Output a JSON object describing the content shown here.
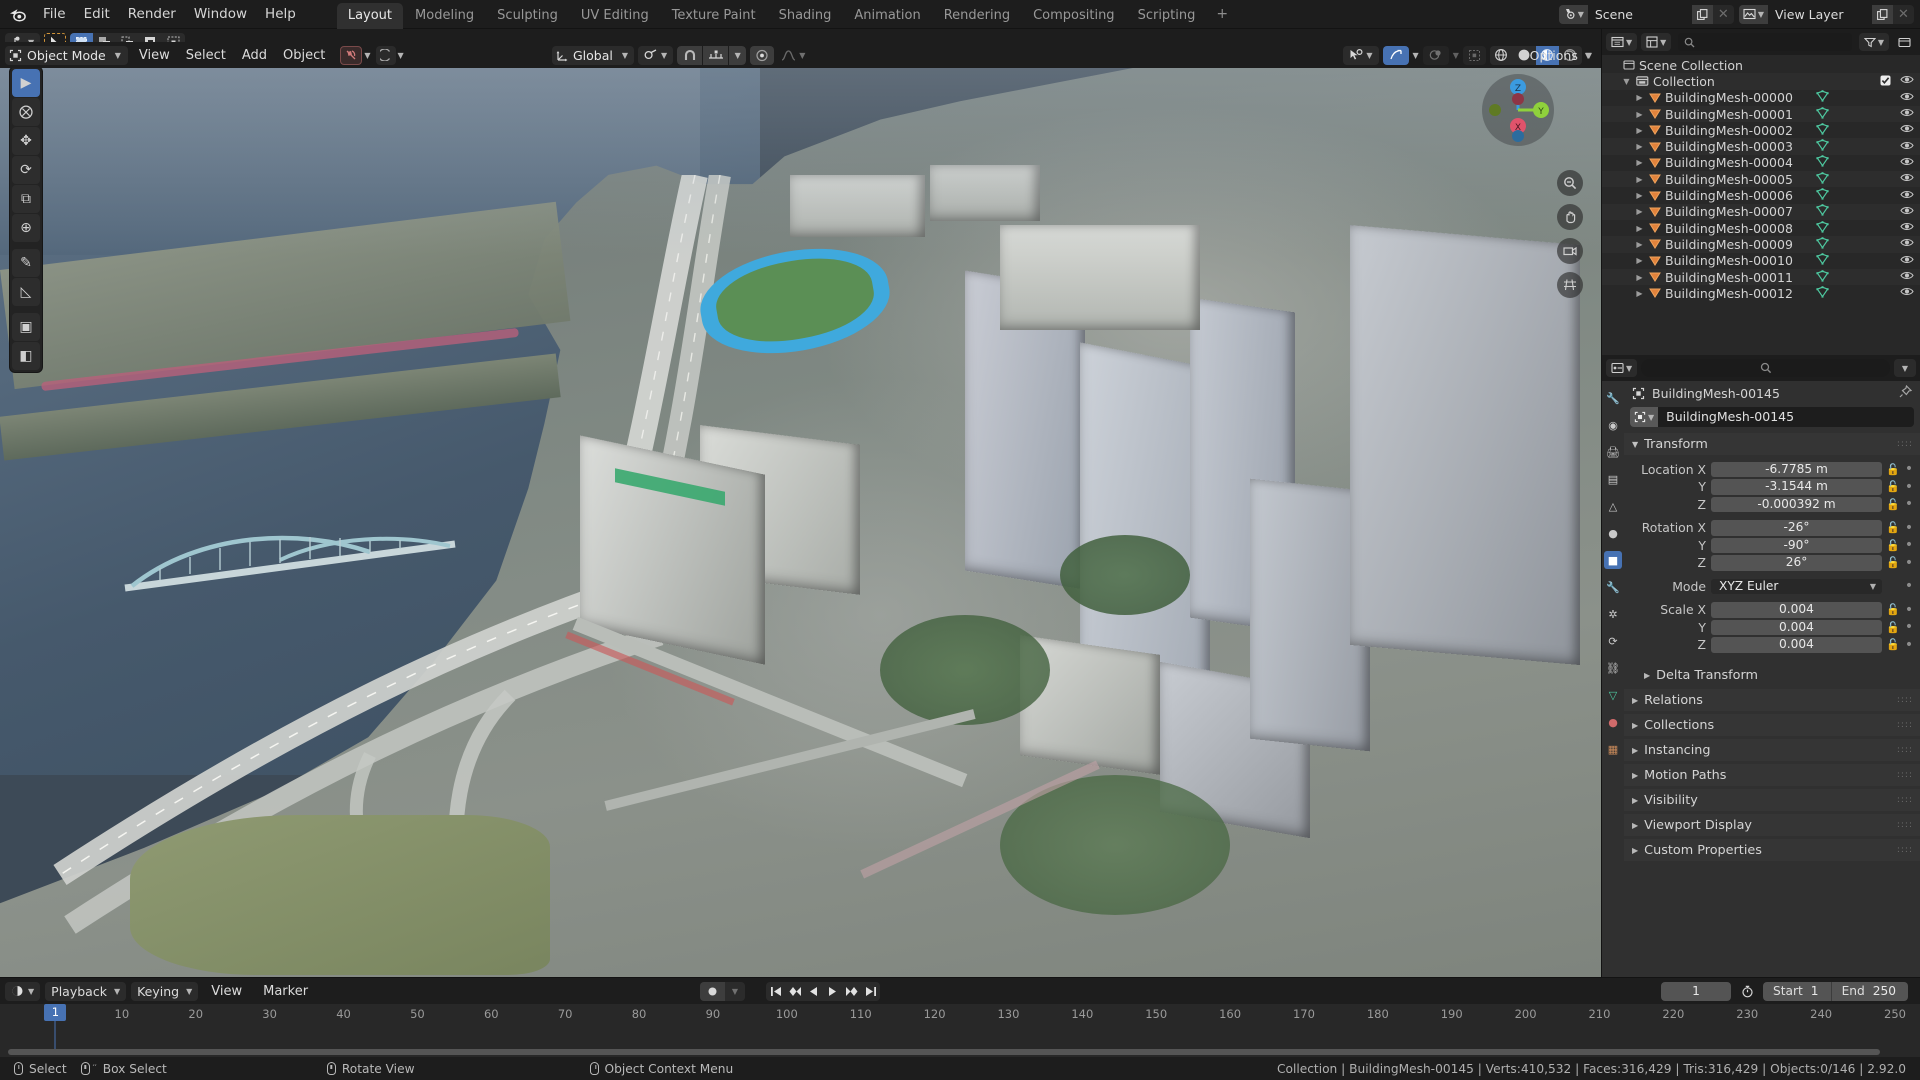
{
  "app": {
    "name": "Blender",
    "version": "2.92.0"
  },
  "topbar": {
    "menus": [
      "File",
      "Edit",
      "Render",
      "Window",
      "Help"
    ],
    "workspaces": [
      {
        "label": "Layout",
        "active": true
      },
      {
        "label": "Modeling",
        "active": false
      },
      {
        "label": "Sculpting",
        "active": false
      },
      {
        "label": "UV Editing",
        "active": false
      },
      {
        "label": "Texture Paint",
        "active": false
      },
      {
        "label": "Shading",
        "active": false
      },
      {
        "label": "Animation",
        "active": false
      },
      {
        "label": "Rendering",
        "active": false
      },
      {
        "label": "Compositing",
        "active": false
      },
      {
        "label": "Scripting",
        "active": false
      }
    ],
    "add_workspace": "+",
    "scene": {
      "icon": "scene-icon",
      "name": "Scene"
    },
    "view_layer": {
      "icon": "view-layer-icon",
      "name": "View Layer"
    }
  },
  "viewport_header": {
    "mode": "Object Mode",
    "menus": [
      "View",
      "Select",
      "Add",
      "Object"
    ],
    "transform_orientation": "Global",
    "snap_icon": "magnet-icon",
    "proportional_icon": "proportional-edit-icon",
    "options_label": "Options"
  },
  "viewport": {
    "gizmo_axes": [
      "X",
      "Y",
      "Z"
    ],
    "tools": [
      {
        "name": "tweak-tool",
        "glyph": "▶",
        "selected": true
      },
      {
        "name": "cursor-tool",
        "glyph": "⨂",
        "selected": false
      },
      {
        "name": "move-tool",
        "glyph": "✥",
        "selected": false
      },
      {
        "name": "rotate-tool",
        "glyph": "⟳",
        "selected": false
      },
      {
        "name": "scale-tool",
        "glyph": "⧉",
        "selected": false
      },
      {
        "name": "transform-tool",
        "glyph": "⊕",
        "selected": false
      },
      {
        "name": "annotate-tool",
        "glyph": "✎",
        "selected": false
      },
      {
        "name": "measure-tool",
        "glyph": "◺",
        "selected": false
      },
      {
        "name": "add-cube-tool",
        "glyph": "▣",
        "selected": false
      },
      {
        "name": "extra-tool",
        "glyph": "◧",
        "selected": false
      }
    ],
    "nav_buttons": [
      "zoom-icon",
      "hand-icon",
      "camera-icon",
      "grid-icon"
    ]
  },
  "outliner": {
    "display_mode": "View Layer",
    "search_placeholder": "",
    "rows": [
      {
        "label": "Scene Collection",
        "indent": 0,
        "icon": "scene-collection-icon",
        "expand": false,
        "check": false,
        "eye": false
      },
      {
        "label": "Collection",
        "indent": 1,
        "icon": "collection-icon",
        "expand": false,
        "check": true,
        "eye": true
      },
      {
        "label": "BuildingMesh-00000",
        "indent": 2,
        "icon": "mesh-object-icon",
        "expand": true,
        "eye": true
      },
      {
        "label": "BuildingMesh-00001",
        "indent": 2,
        "icon": "mesh-object-icon",
        "expand": true,
        "eye": true
      },
      {
        "label": "BuildingMesh-00002",
        "indent": 2,
        "icon": "mesh-object-icon",
        "expand": true,
        "eye": true
      },
      {
        "label": "BuildingMesh-00003",
        "indent": 2,
        "icon": "mesh-object-icon",
        "expand": true,
        "eye": true
      },
      {
        "label": "BuildingMesh-00004",
        "indent": 2,
        "icon": "mesh-object-icon",
        "expand": true,
        "eye": true
      },
      {
        "label": "BuildingMesh-00005",
        "indent": 2,
        "icon": "mesh-object-icon",
        "expand": true,
        "eye": true
      },
      {
        "label": "BuildingMesh-00006",
        "indent": 2,
        "icon": "mesh-object-icon",
        "expand": true,
        "eye": true
      },
      {
        "label": "BuildingMesh-00007",
        "indent": 2,
        "icon": "mesh-object-icon",
        "expand": true,
        "eye": true
      },
      {
        "label": "BuildingMesh-00008",
        "indent": 2,
        "icon": "mesh-object-icon",
        "expand": true,
        "eye": true
      },
      {
        "label": "BuildingMesh-00009",
        "indent": 2,
        "icon": "mesh-object-icon",
        "expand": true,
        "eye": true
      },
      {
        "label": "BuildingMesh-00010",
        "indent": 2,
        "icon": "mesh-object-icon",
        "expand": true,
        "eye": true
      },
      {
        "label": "BuildingMesh-00011",
        "indent": 2,
        "icon": "mesh-object-icon",
        "expand": true,
        "eye": true
      },
      {
        "label": "BuildingMesh-00012",
        "indent": 2,
        "icon": "mesh-object-icon",
        "expand": true,
        "eye": true
      }
    ]
  },
  "properties": {
    "breadcrumb_object": "BuildingMesh-00145",
    "object_name": "BuildingMesh-00145",
    "panels": {
      "transform": {
        "title": "Transform",
        "location_label": "Location X",
        "rotation_label": "Rotation X",
        "scale_label": "Scale X",
        "mode_label": "Mode",
        "axis_y": "Y",
        "axis_z": "Z",
        "location": {
          "x": "-6.7785 m",
          "y": "-3.1544 m",
          "z": "-0.000392 m"
        },
        "rotation": {
          "x": "-26°",
          "y": "-90°",
          "z": "26°"
        },
        "rotation_mode": "XYZ Euler",
        "scale": {
          "x": "0.004",
          "y": "0.004",
          "z": "0.004"
        }
      }
    },
    "collapsed_panels": [
      "Delta Transform",
      "Relations",
      "Collections",
      "Instancing",
      "Motion Paths",
      "Visibility",
      "Viewport Display",
      "Custom Properties"
    ],
    "tabs": [
      {
        "name": "tool-tab",
        "glyph": "🔧",
        "selected": false
      },
      {
        "name": "render-tab",
        "glyph": "◉",
        "selected": false
      },
      {
        "name": "output-tab",
        "glyph": "🖨",
        "selected": false
      },
      {
        "name": "view-layer-tab",
        "glyph": "▤",
        "selected": false
      },
      {
        "name": "scene-tab",
        "glyph": "△",
        "selected": false
      },
      {
        "name": "world-tab",
        "glyph": "●",
        "selected": false
      },
      {
        "name": "object-tab",
        "glyph": "■",
        "selected": true
      },
      {
        "name": "modifier-tab",
        "glyph": "🔧",
        "selected": false
      },
      {
        "name": "particles-tab",
        "glyph": "✲",
        "selected": false
      },
      {
        "name": "physics-tab",
        "glyph": "⟳",
        "selected": false
      },
      {
        "name": "constraints-tab",
        "glyph": "⛓",
        "selected": false
      },
      {
        "name": "data-tab",
        "glyph": "▽",
        "selected": false
      },
      {
        "name": "material-tab",
        "glyph": "●",
        "selected": false
      },
      {
        "name": "texture-tab",
        "glyph": "▦",
        "selected": false
      }
    ]
  },
  "timeline": {
    "editor_type_icon": "timeline-icon",
    "menus": [
      "Playback",
      "Keying",
      "View",
      "Marker"
    ],
    "current_frame": "1",
    "start_label": "Start",
    "start_value": "1",
    "end_label": "End",
    "end_value": "250",
    "playhead_frame": "1",
    "ticks": [
      10,
      20,
      30,
      40,
      50,
      60,
      70,
      80,
      90,
      100,
      110,
      120,
      130,
      140,
      150,
      160,
      170,
      180,
      190,
      200,
      210,
      220,
      230,
      240,
      250
    ]
  },
  "status_bar": {
    "hints": [
      {
        "icon": "mouse-left-icon",
        "label": "Select"
      },
      {
        "icon": "mouse-left-drag-icon",
        "label": "Box Select"
      },
      {
        "icon": "mouse-middle-icon",
        "label": "Rotate View"
      },
      {
        "icon": "mouse-right-icon",
        "label": "Object Context Menu"
      }
    ],
    "scene_stats": "Collection | BuildingMesh-00145 | Verts:410,532 | Faces:316,429 | Tris:316,429 | Objects:0/146 | 2.92.0"
  },
  "colors": {
    "accent_blue": "#4772b3",
    "header_bg": "#1d1d1d",
    "panel_bg": "#303030",
    "outliner_bg": "#282828",
    "mesh_green": "#4ec9a0",
    "object_orange": "#e2833c",
    "axis_x": "#e1536b",
    "axis_y": "#8fd13c",
    "axis_z": "#3b9be0"
  }
}
